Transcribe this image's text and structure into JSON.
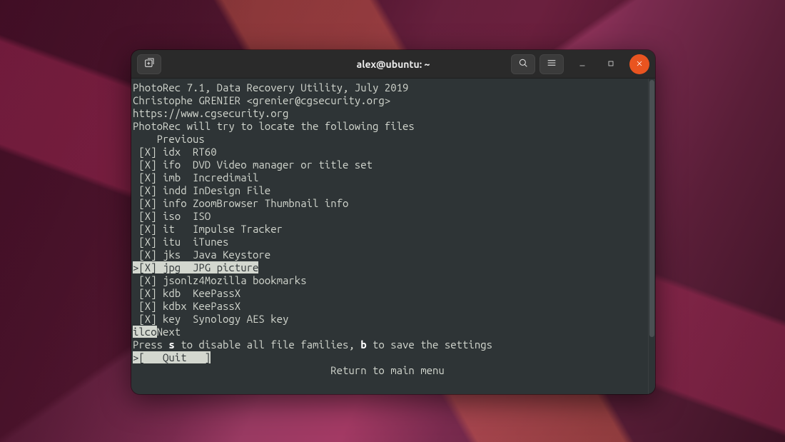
{
  "window": {
    "title": "alex@ubuntu: ~"
  },
  "titlebar_icons": {
    "new_tab": "new-tab-icon",
    "search": "search-icon",
    "menu": "hamburger-icon",
    "minimize": "minimize-icon",
    "maximize": "maximize-icon",
    "close": "close-icon"
  },
  "terminal": {
    "header": [
      "PhotoRec 7.1, Data Recovery Utility, July 2019",
      "Christophe GRENIER <grenier@cgsecurity.org>",
      "https://www.cgsecurity.org"
    ],
    "intro": "PhotoRec will try to locate the following files",
    "previous_label": "    Previous",
    "items": [
      {
        "checked": true,
        "ext": "idx",
        "desc": "RT60",
        "selected": false
      },
      {
        "checked": true,
        "ext": "ifo",
        "desc": "DVD Video manager or title set",
        "selected": false
      },
      {
        "checked": true,
        "ext": "imb",
        "desc": "Incredimail",
        "selected": false
      },
      {
        "checked": true,
        "ext": "indd",
        "desc": "InDesign File",
        "selected": false
      },
      {
        "checked": true,
        "ext": "info",
        "desc": "ZoomBrowser Thumbnail info",
        "selected": false
      },
      {
        "checked": true,
        "ext": "iso",
        "desc": "ISO",
        "selected": false
      },
      {
        "checked": true,
        "ext": "it",
        "desc": "Impulse Tracker",
        "selected": false
      },
      {
        "checked": true,
        "ext": "itu",
        "desc": "iTunes",
        "selected": false
      },
      {
        "checked": true,
        "ext": "jks",
        "desc": "Java Keystore",
        "selected": false
      },
      {
        "checked": true,
        "ext": "jpg",
        "desc": "JPG picture",
        "selected": true
      },
      {
        "checked": true,
        "ext": "jsonlz4",
        "desc": "Mozilla bookmarks",
        "selected": false
      },
      {
        "checked": true,
        "ext": "kdb",
        "desc": "KeePassX",
        "selected": false
      },
      {
        "checked": true,
        "ext": "kdbx",
        "desc": "KeePassX",
        "selected": false
      },
      {
        "checked": true,
        "ext": "key",
        "desc": "Synology AES key",
        "selected": false
      }
    ],
    "typed_prefix": "ilco",
    "next_label": "Next",
    "hint": {
      "prefix": "Press ",
      "key1": "s",
      "mid": " to disable all file families, ",
      "key2": "b",
      "suffix": " to save the settings"
    },
    "quit_button": ">[   Quit   ]",
    "return_label": "Return to main menu"
  }
}
